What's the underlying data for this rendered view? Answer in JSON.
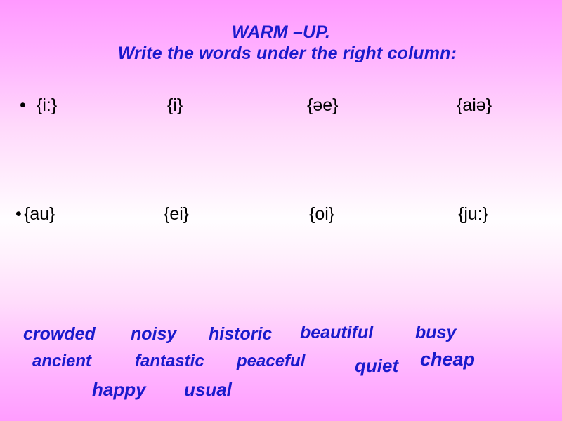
{
  "slide": {
    "title_line_1": "WARM –UP.",
    "title_line_2": "Write the words under the right column:",
    "title_color": "#1a1acc",
    "background_top_color": "#ff99ff",
    "background_mid_color": "#fffdff",
    "background_bottom_color": "#ff9cff",
    "symbol_color": "#000000",
    "word_color": "#1a1acc"
  },
  "symbol_rows": [
    {
      "bullet": "•",
      "symbols": [
        "{i:}",
        "{i}",
        "{əe}",
        "{aiə}"
      ]
    },
    {
      "bullet": "•",
      "symbols": [
        "{au}",
        "{ei}",
        "{oi}",
        "{ju:}"
      ]
    }
  ],
  "word_bank": {
    "lines": [
      [
        "crowded",
        "noisy",
        "historic",
        "beautiful",
        "busy"
      ],
      [
        "ancient",
        "fantastic",
        "peaceful",
        "quiet",
        "cheap"
      ],
      [
        "happy",
        "usual"
      ]
    ]
  }
}
